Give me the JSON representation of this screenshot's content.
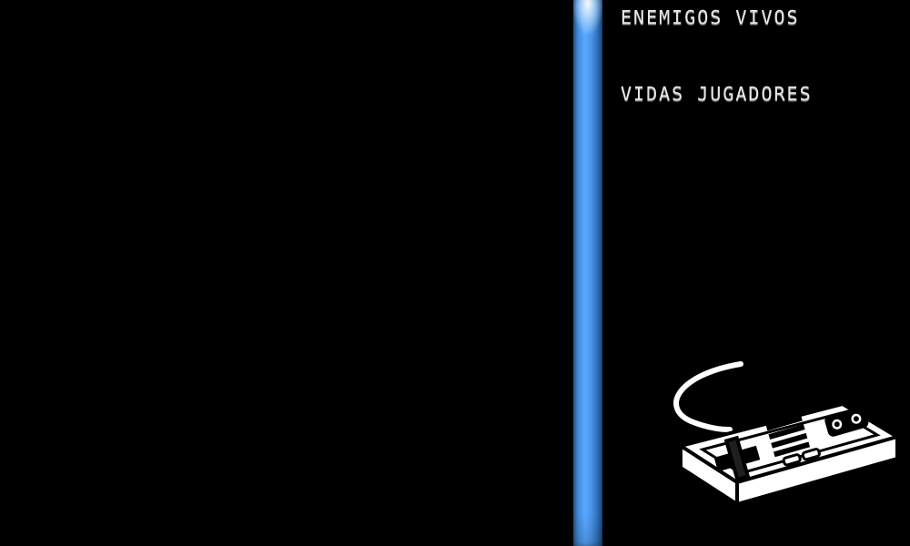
{
  "hud": {
    "enemies_label": "ENEMIGOS VIVOS",
    "lives_label": "VIDAS JUGADORES"
  },
  "icons": {
    "controller": "game-controller-icon"
  },
  "colors": {
    "background": "#000000",
    "divider_blue": "#4c97ee",
    "hud_text": "#e6e6e6",
    "controller_white": "#ffffff"
  }
}
